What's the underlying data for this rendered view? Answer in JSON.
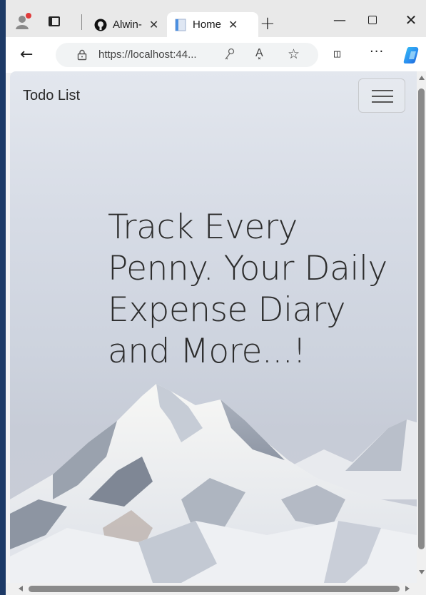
{
  "browser": {
    "tabs": [
      {
        "title": "Alwin-",
        "close": "✕",
        "icon": "github-icon",
        "active": false
      },
      {
        "title": "Home",
        "close": "✕",
        "icon": "page-icon",
        "active": true
      }
    ],
    "new_tab_label": "+",
    "window_controls": {
      "minimize": "—",
      "close": "✕"
    },
    "back_label": "←",
    "url": "https://localhost:44...",
    "read_aloud_label": "A͓",
    "favorite_label": "☆",
    "split_label": "◫",
    "more_label": "···"
  },
  "page": {
    "navbar": {
      "brand": "Todo List"
    },
    "hero": {
      "line1": "Track Every",
      "line2": "Penny. Your Daily",
      "line3": "Expense Diary",
      "line4": "and More...!"
    }
  },
  "colors": {
    "accent_copilot": "#2a8cf0",
    "profile_dot": "#e03b3b",
    "text_dark": "#2d2d2d"
  }
}
